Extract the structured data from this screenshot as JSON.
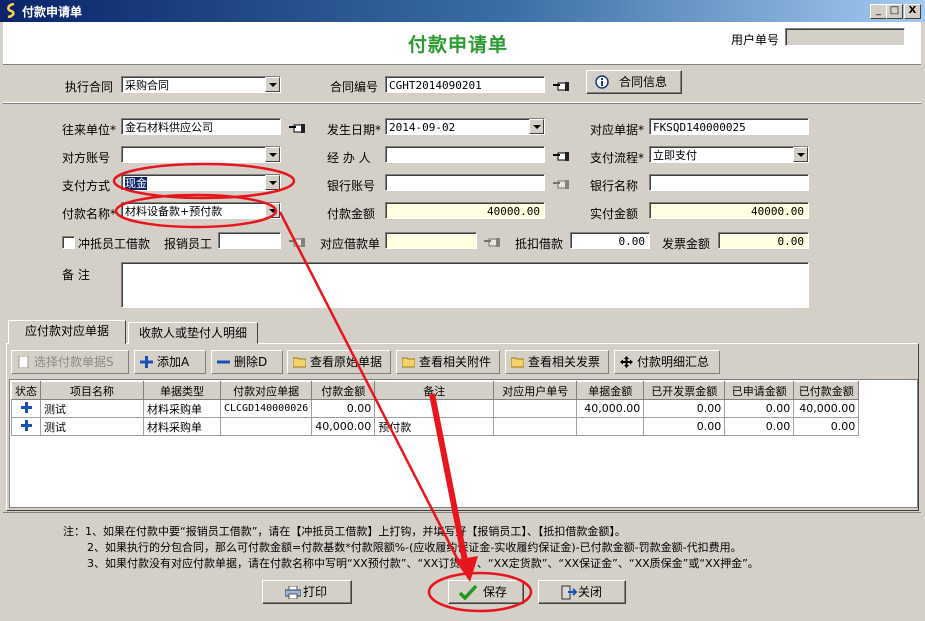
{
  "window": {
    "title": "付款申请单",
    "min": "_",
    "max": "□",
    "close": "X"
  },
  "header": {
    "title": "付款申请单",
    "user_no_label": "用户单号",
    "user_no_value": ""
  },
  "contract": {
    "exec_label": "执行合同",
    "exec_value": "采购合同",
    "no_label": "合同编号",
    "no_value": "CGHT2014090201",
    "info_button": "合同信息"
  },
  "form": {
    "unit_label": "往来单位*",
    "unit_value": "金石材料供应公司",
    "date_label": "发生日期*",
    "date_value": "2014-09-02",
    "doc_label": "对应单据*",
    "doc_value": "FKSQD140000025",
    "account_label": "对方账号",
    "account_value": "",
    "handler_label": "经 办 人",
    "handler_value": "",
    "flow_label": "支付流程*",
    "flow_value": "立即支付",
    "paymethod_label": "支付方式",
    "paymethod_value": "现金",
    "bankacct_label": "银行账号",
    "bankacct_value": "",
    "bankname_label": "银行名称",
    "bankname_value": "",
    "payname_label": "付款名称*",
    "payname_value": "材料设备款+预付款",
    "payamt_label": "付款金额",
    "payamt_value": "40000.00",
    "actual_label": "实付金额",
    "actual_value": "40000.00",
    "loan_check_label": "冲抵员工借款",
    "reimb_label": "报销员工",
    "reimb_value": "",
    "loandoc_label": "对应借款单",
    "loandoc_value": "",
    "deduct_label": "抵扣借款",
    "deduct_value": "0.00",
    "invoice_label": "发票金额",
    "invoice_value": "0.00",
    "remark_label": "备    注",
    "remark_value": ""
  },
  "tabs": [
    {
      "label": "应付款对应单据"
    },
    {
      "label": "收款人或垫付人明细"
    }
  ],
  "toolbar": {
    "select": "选择付款单据S",
    "add": "添加A",
    "delete": "删除D",
    "view_src": "查看原始单据",
    "view_att": "查看相关附件",
    "view_inv": "查看相关发票",
    "summary": "付款明细汇总"
  },
  "table": {
    "headers": [
      "状态",
      "项目名称",
      "单据类型",
      "付款对应单据",
      "付款金额",
      "备注",
      "对应用户单号",
      "单据金额",
      "已开发票金额",
      "已申请金额",
      "已付款金额"
    ],
    "rows": [
      [
        "",
        "测试",
        "材料采购单",
        "CLCGD140000026",
        "0.00",
        "",
        "",
        "40,000.00",
        "0.00",
        "0.00",
        "40,000.00"
      ],
      [
        "",
        "测试",
        "材料采购单",
        "",
        "40,000.00",
        "预付款",
        "",
        "",
        "0.00",
        "0.00",
        "0.00"
      ]
    ]
  },
  "notes": [
    "注：1、如果在付款中要“报销员工借款”，请在【冲抵员工借款】上打钩，并填写好【报销员工】、【抵扣借款金额】。",
    "2、如果执行的分包合同，那么可付款金额=付款基数*付款限额%-(应收履约保证金-实收履约保证金)-已付款金额-罚款金额-代扣费用。",
    "3、如果付款没有对应付款单据，请在付款名称中写明“XX预付款”、“XX订货款”、“XX定货款”、“XX保证金”、“XX质保金”或“XX押金”。"
  ],
  "buttons": {
    "print": "打印",
    "save": "保存",
    "close": "关闭"
  },
  "colors": {
    "title_green": "#2e9a32",
    "annotation_red": "#e8141e",
    "yellow_field": "#ffffe1"
  }
}
